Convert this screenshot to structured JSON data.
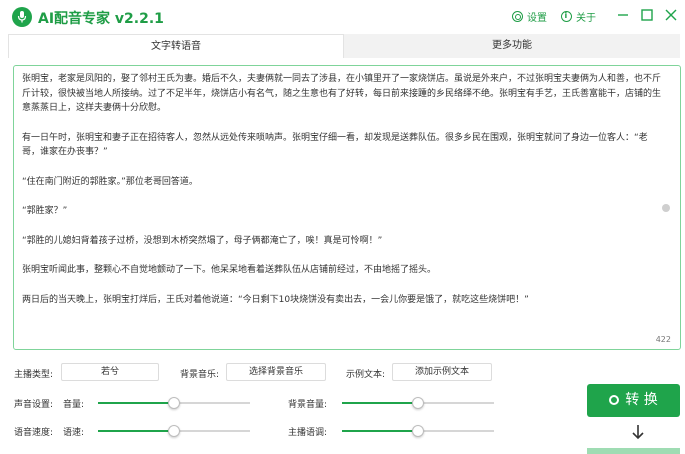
{
  "app": {
    "title": "AI配音专家 v2.2.1",
    "settings_label": "设置",
    "about_label": "关于",
    "accent": "#1fa44b"
  },
  "tabs": [
    {
      "label": "文字转语音",
      "active": true
    },
    {
      "label": "更多功能",
      "active": false
    }
  ],
  "editor": {
    "paragraphs": [
      "张明宝，老家是凤阳的，娶了邻村王氏为妻。婚后不久，夫妻俩就一同去了涉县，在小镇里开了一家烧饼店。虽说是外来户，不过张明宝夫妻俩为人和善，也不斤斤计较，很快被当地人所接纳。过了不足半年，烧饼店小有名气，随之生意也有了好转，每日前来接踵的乡民络绎不绝。张明宝有手艺，王氏善富能干，店铺的生意蒸蒸日上，这样夫妻俩十分欣慰。",
      "有一日午时，张明宝和妻子正在招待客人，忽然从远处传来唢呐声。张明宝仔细一看，却发现是送葬队伍。很多乡民在围观，张明宝就问了身边一位客人：“老哥，谁家在办丧事？”",
      "“住在南门附近的郭胜家。”那位老哥回答道。",
      "“郭胜家？”",
      "“郭胜的儿媳妇背着孩子过桥，没想到木桥突然塌了，母子俩都淹亡了，唉！真是可怜啊！”",
      "张明宝听闻此事，整颗心不自觉地颤动了一下。他呆呆地看着送葬队伍从店铺前经过，不由地摇了摇头。",
      "两日后的当天晚上，张明宝打烊后，王氏对着他说道：“今日剩下10块烧饼没有卖出去，一会儿你要是饿了，就吃这些烧饼吧！”"
    ],
    "char_count": "422"
  },
  "controls": {
    "anchor_type_label": "主播类型:",
    "anchor_type_value": "若兮",
    "bg_music_label": "背景音乐:",
    "bg_music_button": "选择背景音乐",
    "sample_text_label": "示例文本:",
    "sample_text_button": "添加示例文本",
    "voice_settings_label": "声音设置:",
    "volume_label": "音量:",
    "volume_value": 0.5,
    "bg_volume_label": "背景音量:",
    "bg_volume_value": 0.5,
    "speed_setting_label": "语音速度:",
    "speed_label": "语速:",
    "speed_value": 0.5,
    "intonation_label": "主播语调:",
    "intonation_value": 0.5
  },
  "convert": {
    "label": "转 换"
  }
}
